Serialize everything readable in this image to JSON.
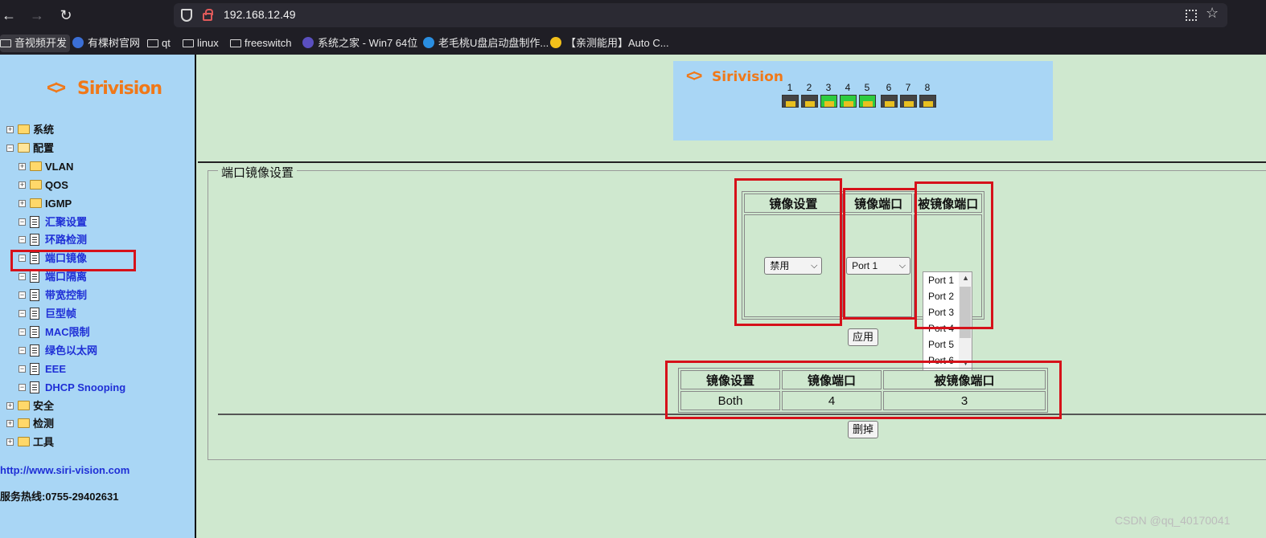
{
  "browser": {
    "url": "192.168.12.49",
    "bookmarks": [
      {
        "label": "音视频开发",
        "kind": "folder"
      },
      {
        "label": "有棵树官网",
        "kind": "site"
      },
      {
        "label": "qt",
        "kind": "folder"
      },
      {
        "label": "linux",
        "kind": "folder"
      },
      {
        "label": "freeswitch",
        "kind": "folder"
      },
      {
        "label": "系统之家 - Win7 64位",
        "kind": "site"
      },
      {
        "label": "老毛桃U盘启动盘制作...",
        "kind": "site"
      },
      {
        "label": "【亲测能用】Auto C...",
        "kind": "site"
      }
    ]
  },
  "sidebar": {
    "logo_text": "Sirivision",
    "tree": [
      {
        "label": "系统",
        "expander": "+",
        "icon": "folder"
      },
      {
        "label": "配置",
        "expander": "-",
        "icon": "folder-open"
      },
      {
        "label": "VLAN",
        "expander": "+",
        "icon": "folder"
      },
      {
        "label": "QOS",
        "expander": "+",
        "icon": "folder"
      },
      {
        "label": "IGMP",
        "expander": "+",
        "icon": "folder"
      },
      {
        "label": "汇聚设置",
        "expander": "-",
        "icon": "document"
      },
      {
        "label": "环路检测",
        "expander": "-",
        "icon": "document"
      },
      {
        "label": "端口镜像",
        "expander": "-",
        "icon": "document"
      },
      {
        "label": "端口隔离",
        "expander": "-",
        "icon": "document"
      },
      {
        "label": "带宽控制",
        "expander": "-",
        "icon": "document"
      },
      {
        "label": "巨型帧",
        "expander": "-",
        "icon": "document"
      },
      {
        "label": "MAC限制",
        "expander": "-",
        "icon": "document"
      },
      {
        "label": "绿色以太网",
        "expander": "-",
        "icon": "document"
      },
      {
        "label": "EEE",
        "expander": "-",
        "icon": "document"
      },
      {
        "label": "DHCP Snooping",
        "expander": "-",
        "icon": "document"
      },
      {
        "label": "安全",
        "expander": "+",
        "icon": "folder"
      },
      {
        "label": "检测",
        "expander": "+",
        "icon": "folder"
      },
      {
        "label": "工具",
        "expander": "+",
        "icon": "folder"
      }
    ],
    "website": "http://www.siri-vision.com",
    "hotline": "服务热线:0755-29402631"
  },
  "banner": {
    "logo_text": "Sirivision",
    "ports": [
      {
        "label": "1",
        "status": "down"
      },
      {
        "label": "2",
        "status": "down"
      },
      {
        "label": "3",
        "status": "up"
      },
      {
        "label": "4",
        "status": "up"
      },
      {
        "label": "5",
        "status": "up"
      },
      {
        "label": "6",
        "status": "down"
      },
      {
        "label": "7",
        "status": "down"
      },
      {
        "label": "8",
        "status": "down"
      }
    ],
    "colors": {
      "up": "#2ecc40",
      "down": "#444444"
    }
  },
  "mirror": {
    "legend": "端口镜像设置",
    "headers": {
      "mode": "镜像设置",
      "mirror_port": "镜像端口",
      "mirrored_ports": "被镜像端口"
    },
    "mode_value": "禁用",
    "mirror_port_value": "Port 1",
    "mirrored_options": [
      "Port 1",
      "Port 2",
      "Port 3",
      "Port 4",
      "Port 5",
      "Port 6"
    ],
    "apply_label": "应用",
    "result_headers": [
      "镜像设置",
      "镜像端口",
      "被镜像端口"
    ],
    "result_row": [
      "Both",
      "4",
      "3"
    ],
    "delete_label": "删掉"
  },
  "watermark": "CSDN @qq_40170041",
  "colors": {
    "highlight_box": "#d6111a",
    "sidebar_bg": "#a9d6f5",
    "page_bg": "#cfe8cf"
  }
}
